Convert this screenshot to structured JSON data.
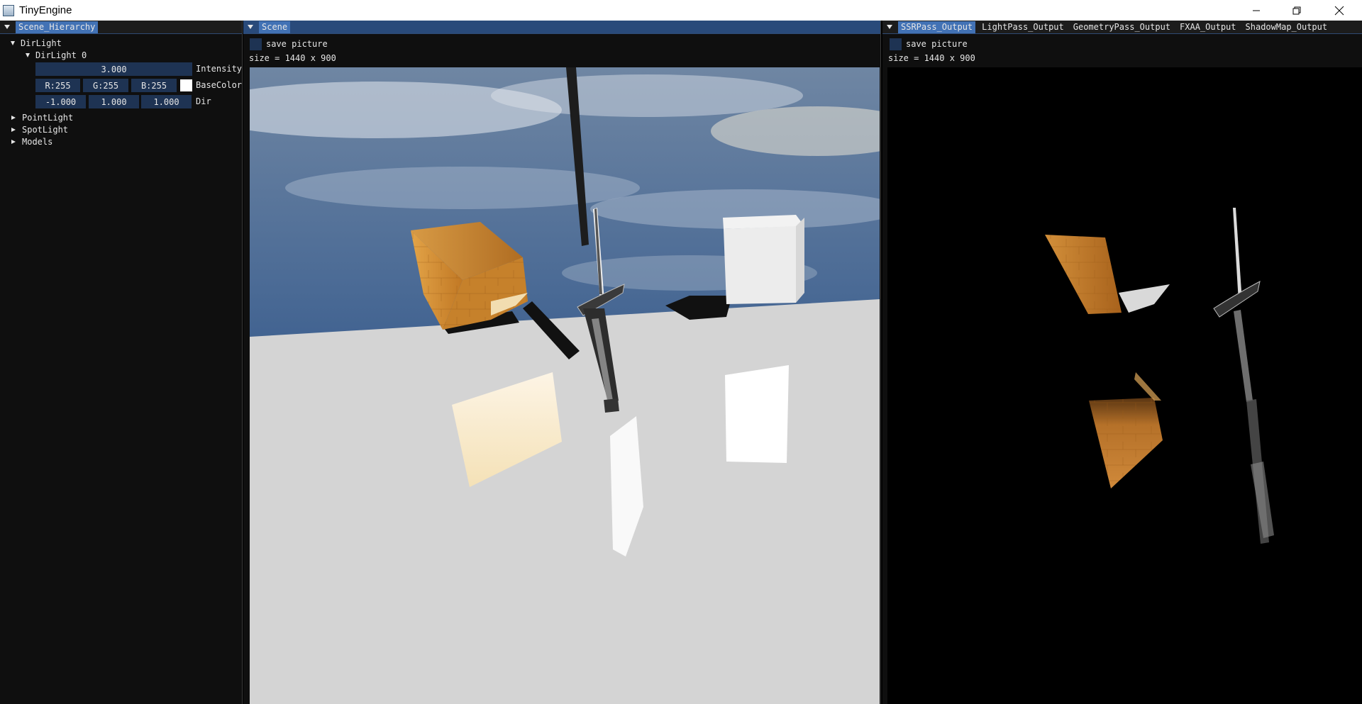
{
  "window": {
    "title": "TinyEngine",
    "minimize_icon": "minimize-icon",
    "restore_icon": "restore-icon",
    "close_icon": "close-icon"
  },
  "hierarchy": {
    "tab": "Scene_Hierarchy",
    "dirlight_group": "DirLight",
    "dirlight_item": "DirLight 0",
    "intensity_value": "3.000",
    "intensity_label": "Intensity",
    "color_r": "R:255",
    "color_g": "G:255",
    "color_b": "B:255",
    "color_label": "BaseColor",
    "color_swatch": "#ffffff",
    "dir_x": "-1.000",
    "dir_y": "1.000",
    "dir_z": "1.000",
    "dir_label": "Dir",
    "pointlight": "PointLight",
    "spotlight": "SpotLight",
    "models": "Models"
  },
  "scene": {
    "tab": "Scene",
    "save_label": "save picture",
    "size_text": "size = 1440 x 900"
  },
  "output": {
    "tabs": [
      "SSRPass_Output",
      "LightPass_Output",
      "GeometryPass_Output",
      "FXAA_Output",
      "ShadowMap_Output"
    ],
    "selected_tab": "SSRPass_Output",
    "save_label": "save picture",
    "size_text": "size = 1440 x 900"
  },
  "colors": {
    "accent": "#4272b5",
    "field_bg": "#1e3353",
    "panel_bg": "#0f0f0f",
    "floor": "#d4d4d4",
    "wood": "#c98a2f"
  }
}
